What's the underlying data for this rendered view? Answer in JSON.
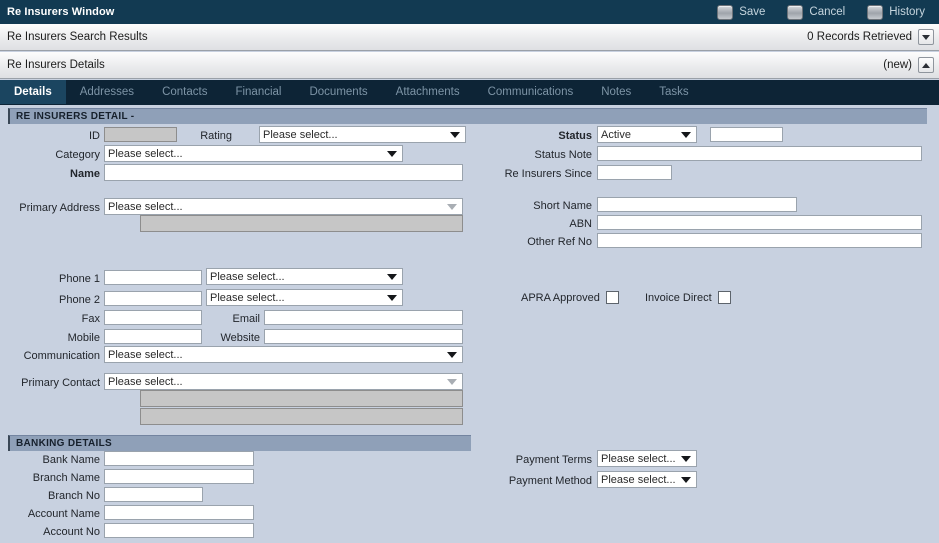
{
  "window": {
    "title": "Re Insurers Window",
    "actions": [
      {
        "label": "Save",
        "icon": "save-icon"
      },
      {
        "label": "Cancel",
        "icon": "cancel-icon"
      },
      {
        "label": "History",
        "icon": "history-icon"
      }
    ]
  },
  "bands": {
    "search": {
      "title": "Re Insurers Search Results",
      "status": "0 Records Retrieved",
      "chevron": "chevron-down-icon"
    },
    "details": {
      "title": "Re Insurers Details",
      "status": "(new)",
      "chevron": "chevron-up-icon"
    }
  },
  "tabs": [
    {
      "label": "Details",
      "active": true
    },
    {
      "label": "Addresses",
      "active": false
    },
    {
      "label": "Contacts",
      "active": false
    },
    {
      "label": "Financial",
      "active": false
    },
    {
      "label": "Documents",
      "active": false
    },
    {
      "label": "Attachments",
      "active": false
    },
    {
      "label": "Communications",
      "active": false
    },
    {
      "label": "Notes",
      "active": false
    },
    {
      "label": "Tasks",
      "active": false
    }
  ],
  "placeholders": {
    "select": "Please select..."
  },
  "sections": {
    "detail": {
      "heading": "RE INSURERS DETAIL -",
      "labels": {
        "id": "ID",
        "rating": "Rating",
        "category": "Category",
        "name": "Name",
        "primary_address": "Primary Address",
        "status": "Status",
        "status_note": "Status Note",
        "re_insurers_since": "Re Insurers Since",
        "short_name": "Short Name",
        "abn": "ABN",
        "other_ref_no": "Other Ref No",
        "phone1": "Phone 1",
        "phone2": "Phone 2",
        "fax": "Fax",
        "mobile": "Mobile",
        "email": "Email",
        "website": "Website",
        "communication": "Communication",
        "primary_contact": "Primary Contact",
        "apra_approved": "APRA Approved",
        "invoice_direct": "Invoice Direct"
      },
      "values": {
        "id": "",
        "rating": "Please select...",
        "category": "Please select...",
        "name": "",
        "primary_address": "Please select...",
        "primary_address_detail": "",
        "status": "Active",
        "status_extra": "",
        "status_note": "",
        "re_insurers_since": "",
        "short_name": "",
        "abn": "",
        "other_ref_no": "",
        "phone1": "",
        "phone1_type": "Please select...",
        "phone2": "",
        "phone2_type": "Please select...",
        "fax": "",
        "mobile": "",
        "email": "",
        "website": "",
        "communication": "Please select...",
        "primary_contact": "Please select...",
        "primary_contact_line1": "",
        "primary_contact_line2": "",
        "apra_approved": false,
        "invoice_direct": false
      }
    },
    "banking": {
      "heading": "BANKING DETAILS",
      "labels": {
        "bank_name": "Bank Name",
        "branch_name": "Branch Name",
        "branch_no": "Branch No",
        "account_name": "Account Name",
        "account_no": "Account No",
        "payment_terms": "Payment Terms",
        "payment_method": "Payment Method"
      },
      "values": {
        "bank_name": "",
        "branch_name": "",
        "branch_no": "",
        "account_name": "",
        "account_no": "",
        "payment_terms": "Please select...",
        "payment_method": "Please select..."
      }
    }
  },
  "colors": {
    "titlebar": "#123a52",
    "tabbar": "#0d2436",
    "tab_active": "#1b4560",
    "form_bg": "#c8d1e0",
    "section_head": "#8fa0b8",
    "readonly_field": "#c6c6c6"
  }
}
